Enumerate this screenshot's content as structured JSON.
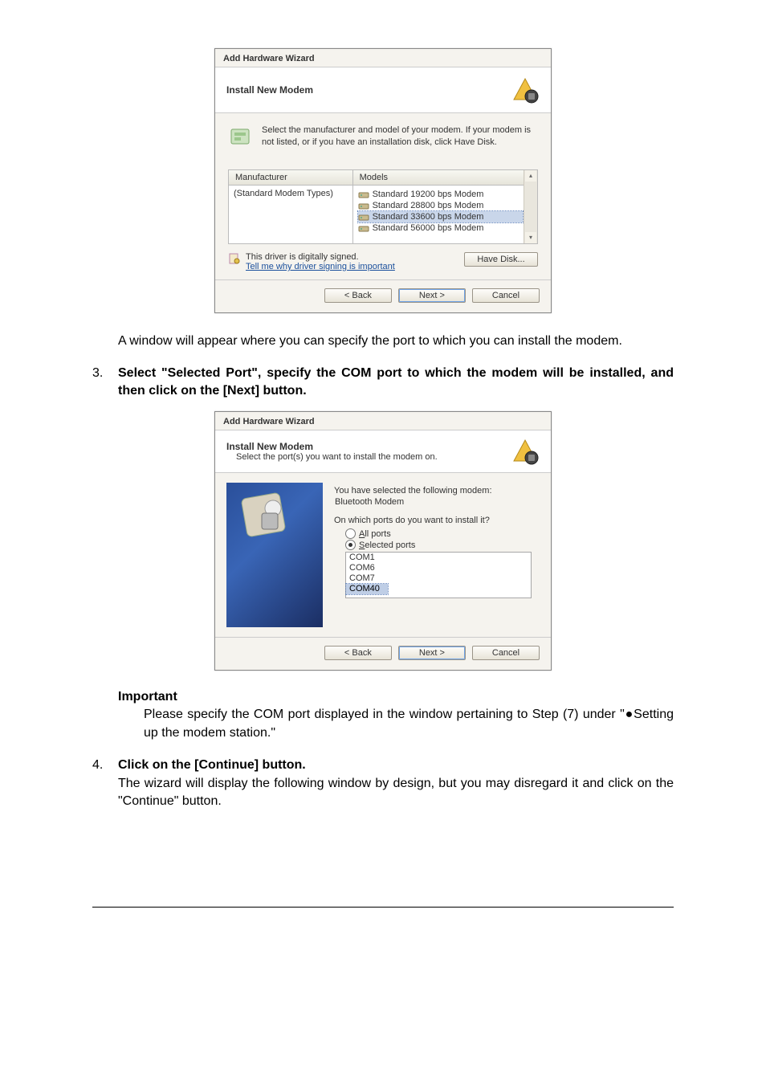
{
  "wizard1": {
    "title": "Add Hardware Wizard",
    "header": "Install New Modem",
    "instruction": "Select the manufacturer and model of your modem. If your modem is not listed, or if you have an installation disk, click Have Disk.",
    "col_manufacturer": "Manufacturer",
    "col_models": "Models",
    "manufacturer_item": "(Standard Modem Types)",
    "models": [
      "Standard 19200 bps Modem",
      "Standard 28800 bps Modem",
      "Standard 33600 bps Modem",
      "Standard 56000 bps Modem"
    ],
    "signed_text": "This driver is digitally signed.",
    "signed_link": "Tell me why driver signing is important",
    "have_disk": "Have Disk...",
    "back": "< Back",
    "next": "Next >",
    "cancel": "Cancel"
  },
  "doc": {
    "para1": "A window will appear where you can specify the port to which you can install the modem.",
    "step3_num": "3.",
    "step3_text": "Select \"Selected Port\", specify the COM port to which the modem will be installed, and then click on the [Next] button.",
    "important_label": "Important",
    "important_text": "Please specify the COM port displayed in the window pertaining to Step (7) under \"●Setting up the modem station.\"",
    "step4_num": "4.",
    "step4_title": "Click on the [Continue] button.",
    "step4_text": "The wizard will display the following window by design, but you may disregard it and click on the \"Continue\" button."
  },
  "wizard2": {
    "title": "Add Hardware Wizard",
    "header": "Install New Modem",
    "subheader": "Select the port(s) you want to install the modem on.",
    "selected_label": "You have selected the following modem:",
    "modem_name": "Bluetooth Modem",
    "ports_question": "On which ports do you want to install it?",
    "radio_all": "All ports",
    "radio_selected": "Selected ports",
    "ports": [
      "COM1",
      "COM6",
      "COM7",
      "COM40"
    ],
    "back": "< Back",
    "next": "Next >",
    "cancel": "Cancel"
  }
}
